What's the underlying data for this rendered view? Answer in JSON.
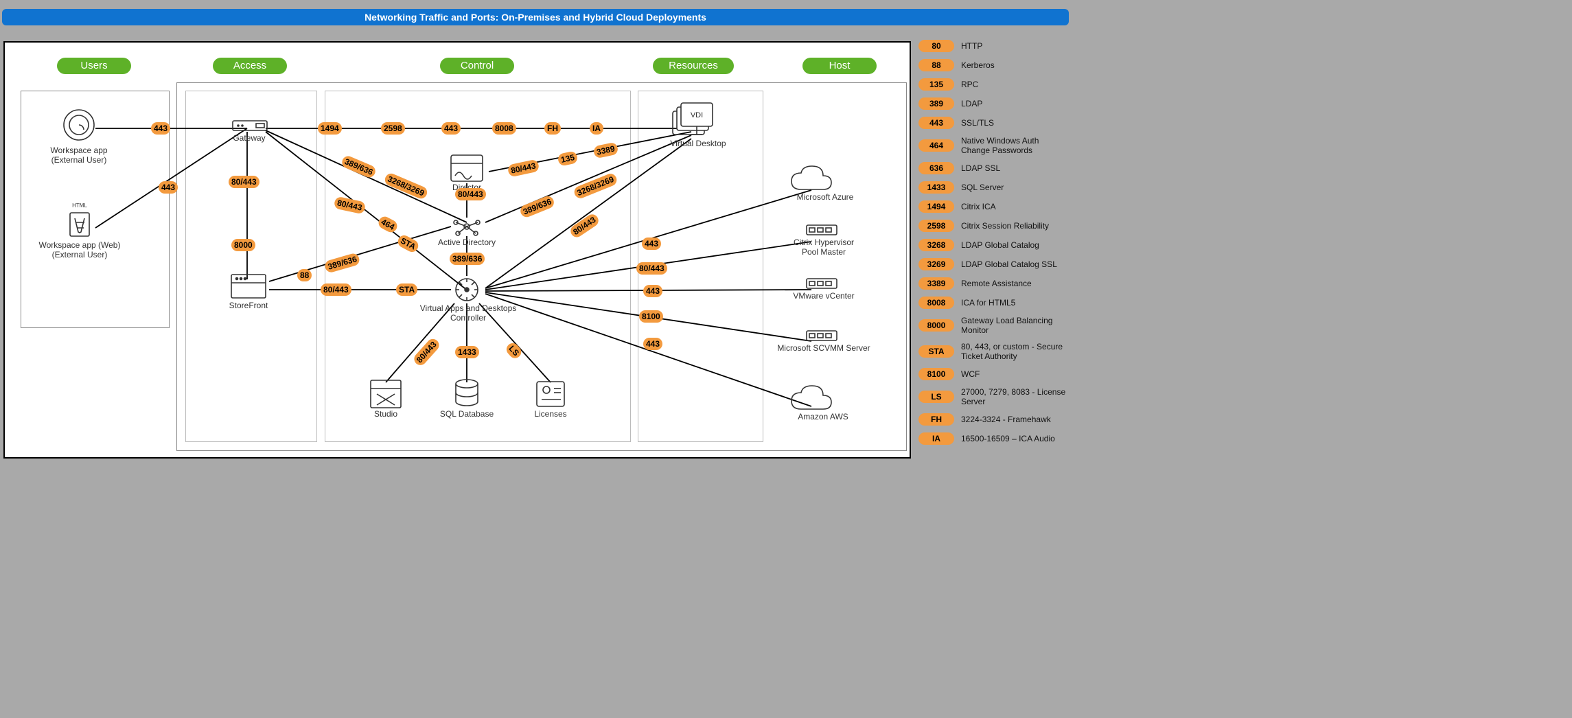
{
  "title": "Networking Traffic and Ports: On-Premises and Hybrid Cloud Deployments",
  "columns": {
    "users": "Users",
    "access": "Access",
    "control": "Control",
    "resources": "Resources",
    "host": "Host"
  },
  "nodes": {
    "ws_ext": "Workspace app\n(External User)",
    "ws_web": "Workspace app (Web)\n(External User)",
    "gateway": "Gateway",
    "storefront": "StoreFront",
    "director": "Director",
    "ad": "Active Directory",
    "controller": "Virtual Apps and Desktops\nController",
    "studio": "Studio",
    "sql": "SQL Database",
    "licenses": "Licenses",
    "vdi_badge": "VDI",
    "vdi": "Virtual Desktop",
    "azure": "Microsoft Azure",
    "chv": "Citrix Hypervisor\nPool Master",
    "vcenter": "VMware vCenter",
    "scvmm": "Microsoft SCVMM Server",
    "aws": "Amazon AWS"
  },
  "ports": {
    "p1": "443",
    "p2": "443",
    "p3": "1494",
    "p4": "2598",
    "p5": "443",
    "p6": "8008",
    "p7": "FH",
    "p8": "IA",
    "p9": "80/443",
    "p10": "8000",
    "p11": "88",
    "p12": "80/443",
    "p13": "389/636",
    "p14": "3268/3269",
    "p15": "464",
    "p16": "STA",
    "p17": "80/443",
    "p18": "389/636",
    "p19": "80/443",
    "p20": "STA",
    "p21": "80/443",
    "p22": "135",
    "p23": "3389",
    "p24": "389/636",
    "p25": "3268/3269",
    "p26": "80/443",
    "p27": "389/636",
    "p28": "443",
    "p29": "80/443",
    "p30": "443",
    "p31": "8100",
    "p32": "443",
    "p33": "80/443",
    "p34": "1433",
    "p35": "LS"
  },
  "legend": [
    {
      "code": "80",
      "desc": "HTTP"
    },
    {
      "code": "88",
      "desc": "Kerberos"
    },
    {
      "code": "135",
      "desc": "RPC"
    },
    {
      "code": "389",
      "desc": "LDAP"
    },
    {
      "code": "443",
      "desc": "SSL/TLS"
    },
    {
      "code": "464",
      "desc": "Native Windows Auth Change Passwords"
    },
    {
      "code": "636",
      "desc": "LDAP SSL"
    },
    {
      "code": "1433",
      "desc": "SQL Server"
    },
    {
      "code": "1494",
      "desc": "Citrix ICA"
    },
    {
      "code": "2598",
      "desc": "Citrix Session Reliability"
    },
    {
      "code": "3268",
      "desc": "LDAP Global Catalog"
    },
    {
      "code": "3269",
      "desc": "LDAP Global Catalog SSL"
    },
    {
      "code": "3389",
      "desc": "Remote Assistance"
    },
    {
      "code": "8008",
      "desc": "ICA for HTML5"
    },
    {
      "code": "8000",
      "desc": "Gateway Load Balancing Monitor"
    },
    {
      "code": "STA",
      "desc": "80, 443, or custom - Secure Ticket Authority"
    },
    {
      "code": "8100",
      "desc": "WCF"
    },
    {
      "code": "LS",
      "desc": "27000, 7279, 8083 - License Server"
    },
    {
      "code": "FH",
      "desc": "3224-3324 - Framehawk"
    },
    {
      "code": "IA",
      "desc": "16500-16509 – ICA Audio"
    }
  ]
}
